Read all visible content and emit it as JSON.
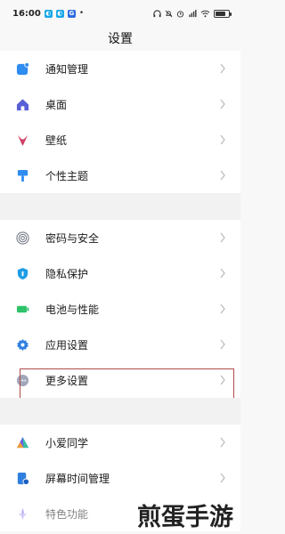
{
  "status_bar": {
    "time": "16:00",
    "app_icons": [
      {
        "name": "app-notification-icon-1",
        "color": "#19a6e8"
      },
      {
        "name": "app-notification-icon-2",
        "color": "#19a6e8"
      },
      {
        "name": "app-notification-icon-3",
        "color": "#2b6be0"
      }
    ],
    "battery_level": 0.75
  },
  "page": {
    "title": "设置"
  },
  "groups": [
    {
      "items": [
        {
          "label": "通知管理",
          "icon": "notification-icon",
          "color": "#2f8cf0"
        },
        {
          "label": "桌面",
          "icon": "home-icon",
          "color": "#5a5fd6"
        },
        {
          "label": "壁纸",
          "icon": "wallpaper-icon",
          "color": "#e0577a"
        },
        {
          "label": "个性主题",
          "icon": "theme-brush-icon",
          "color": "#2f8cf0"
        }
      ]
    },
    {
      "items": [
        {
          "label": "密码与安全",
          "icon": "fingerprint-icon",
          "color": "#7a7f8c"
        },
        {
          "label": "隐私保护",
          "icon": "privacy-shield-icon",
          "color": "#1e9de6"
        },
        {
          "label": "电池与性能",
          "icon": "battery-icon",
          "color": "#2ec26a"
        },
        {
          "label": "应用设置",
          "icon": "app-settings-gear-icon",
          "color": "#2f7fe0"
        },
        {
          "label": "更多设置",
          "icon": "more-settings-icon",
          "color": "#7a7f8c"
        }
      ]
    },
    {
      "items": [
        {
          "label": "小爱同学",
          "icon": "xiaoai-assistant-icon",
          "color": "#6b5cf0"
        },
        {
          "label": "屏幕时间管理",
          "icon": "screen-time-icon",
          "color": "#2f7fe0"
        },
        {
          "label": "特色功能",
          "icon": "special-features-icon",
          "color": "#8a7cf0"
        }
      ]
    }
  ],
  "highlighted_item": "更多设置",
  "watermark": "煎蛋手游"
}
